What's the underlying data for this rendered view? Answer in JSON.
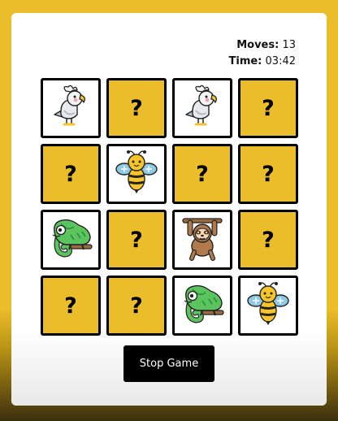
{
  "stats": {
    "moves_label": "Moves:",
    "moves": "13",
    "time_label": "Time:",
    "time": "03:42"
  },
  "board": {
    "hidden_symbol": "?",
    "cards": [
      {
        "state": "revealed",
        "icon": "cockatoo-icon"
      },
      {
        "state": "hidden"
      },
      {
        "state": "revealed",
        "icon": "cockatoo-icon"
      },
      {
        "state": "hidden"
      },
      {
        "state": "hidden"
      },
      {
        "state": "revealed",
        "icon": "bee-icon"
      },
      {
        "state": "hidden"
      },
      {
        "state": "hidden"
      },
      {
        "state": "revealed",
        "icon": "chameleon-icon"
      },
      {
        "state": "hidden"
      },
      {
        "state": "revealed",
        "icon": "sloth-icon"
      },
      {
        "state": "hidden"
      },
      {
        "state": "hidden"
      },
      {
        "state": "hidden"
      },
      {
        "state": "revealed",
        "icon": "chameleon-icon"
      },
      {
        "state": "revealed",
        "icon": "bee-icon"
      }
    ]
  },
  "stop_button": {
    "label": "Stop Game"
  },
  "colors": {
    "background": "#ecbd2b",
    "hidden_card": "#ecbd2b",
    "button": "#000000"
  }
}
